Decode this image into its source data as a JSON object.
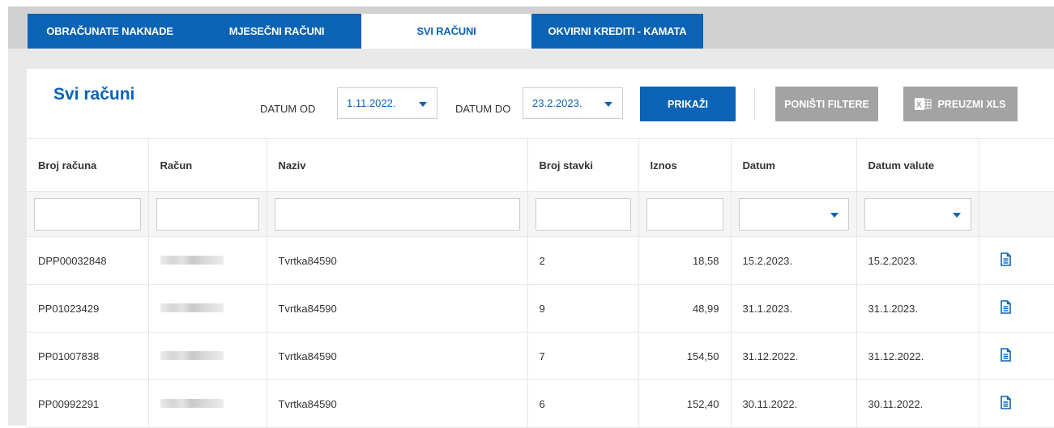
{
  "tabs": [
    {
      "label": "OBRAČUNATE NAKNADE",
      "active": false
    },
    {
      "label": "MJESEČNI RAČUNI",
      "active": false
    },
    {
      "label": "SVI RAČUNI",
      "active": true
    },
    {
      "label": "OKVIRNI KREDITI - KAMATA",
      "active": false
    }
  ],
  "panel": {
    "title": "Svi računi",
    "filters": {
      "date_from_label": "DATUM OD",
      "date_from_value": "1.11.2022.",
      "date_to_label": "DATUM DO",
      "date_to_value": "23.2.2023."
    },
    "buttons": {
      "show": "PRIKAŽI",
      "reset": "PONIŠTI FILTERE",
      "download": "PREUZMI XLS"
    }
  },
  "table": {
    "columns": [
      "Broj računa",
      "Račun",
      "Naziv",
      "Broj stavki",
      "Iznos",
      "Datum",
      "Datum valute"
    ],
    "rows": [
      {
        "broj": "DPP00032848",
        "naziv": "Tvrtka84590",
        "stavki": "2",
        "iznos": "18,58",
        "datum": "15.2.2023.",
        "valuta": "15.2.2023."
      },
      {
        "broj": "PP01023429",
        "naziv": "Tvrtka84590",
        "stavki": "9",
        "iznos": "48,99",
        "datum": "31.1.2023.",
        "valuta": "31.1.2023."
      },
      {
        "broj": "PP01007838",
        "naziv": "Tvrtka84590",
        "stavki": "7",
        "iznos": "154,50",
        "datum": "31.12.2022.",
        "valuta": "31.12.2022."
      },
      {
        "broj": "PP00992291",
        "naziv": "Tvrtka84590",
        "stavki": "6",
        "iznos": "152,40",
        "datum": "30.11.2022.",
        "valuta": "30.11.2022."
      }
    ]
  },
  "colors": {
    "primary": "#0b63b5",
    "disabled": "#a3a3a3"
  },
  "icons": {
    "row_action": "document-icon",
    "caret": "caret-down-icon",
    "excel": "excel-icon"
  }
}
